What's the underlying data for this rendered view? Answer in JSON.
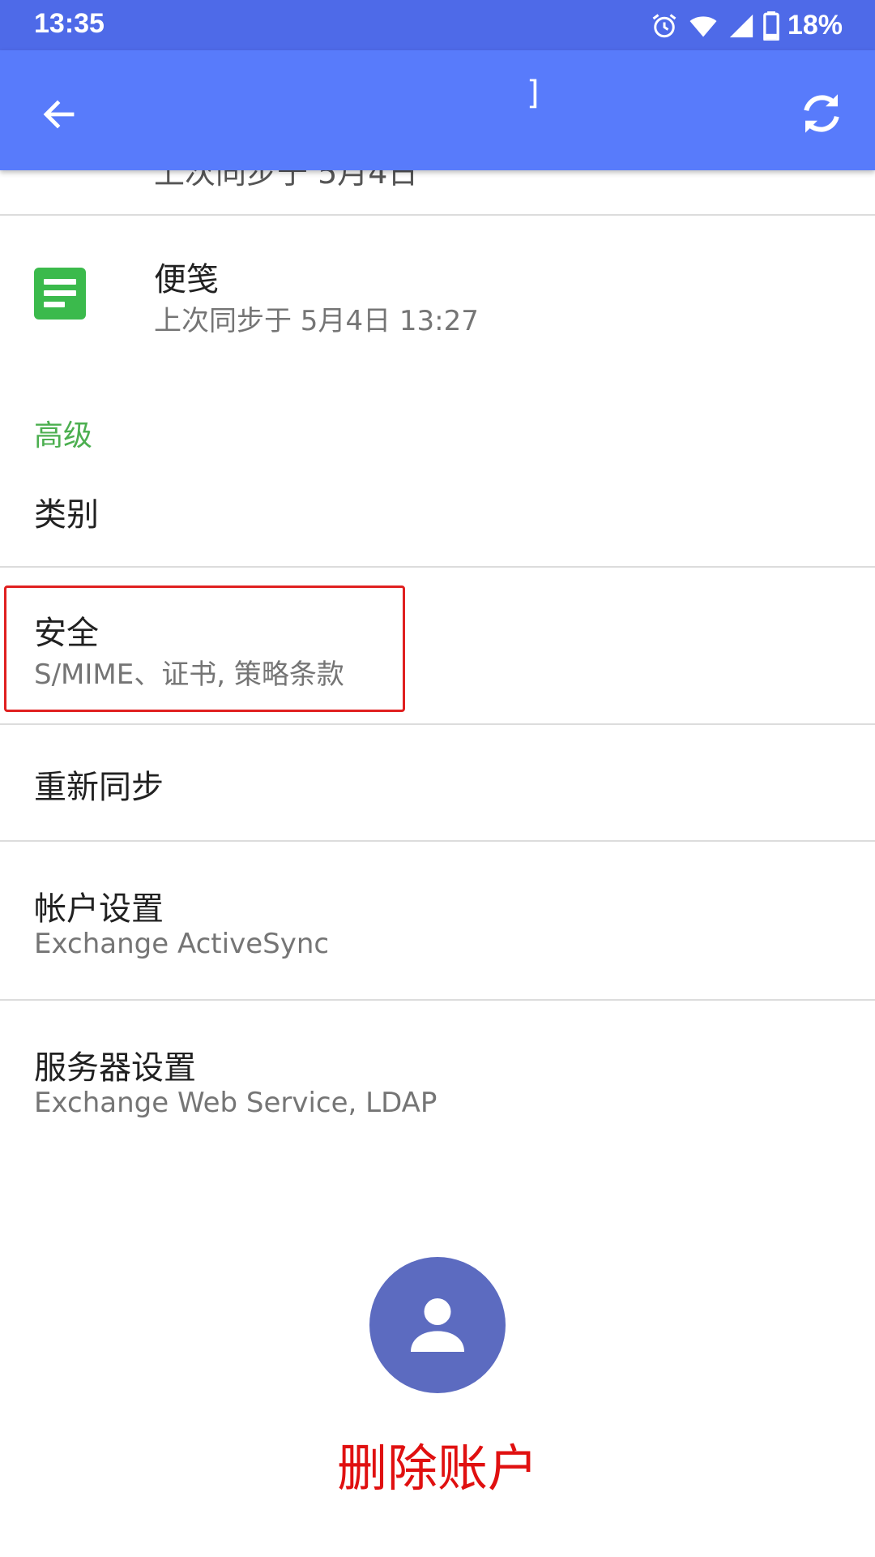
{
  "status_bar": {
    "time": "13:35",
    "battery": "18%"
  },
  "app_bar": {
    "title_fragment": "]"
  },
  "partial_row": {
    "text": "上次同步于 5月4日"
  },
  "notes": {
    "title": "便笺",
    "subtitle": "上次同步于 5月4日 13:27",
    "icon_color": "#3bba4c"
  },
  "advanced_section": {
    "header": "高级",
    "header_color": "#4caf50"
  },
  "items": {
    "category": {
      "title": "类别"
    },
    "security": {
      "title": "安全",
      "subtitle": "S/MIME、证书, 策略条款"
    },
    "resync": {
      "title": "重新同步"
    },
    "account_settings": {
      "title": "帐户设置",
      "subtitle": "Exchange ActiveSync"
    },
    "server_settings": {
      "title": "服务器设置",
      "subtitle": "Exchange Web Service, LDAP"
    }
  },
  "delete_account": {
    "label": "删除账户",
    "color": "#e01010"
  },
  "colors": {
    "status_bar": "#4e6ae8",
    "app_bar": "#587bfb",
    "avatar": "#5c6bc0",
    "highlight": "#e02020"
  }
}
